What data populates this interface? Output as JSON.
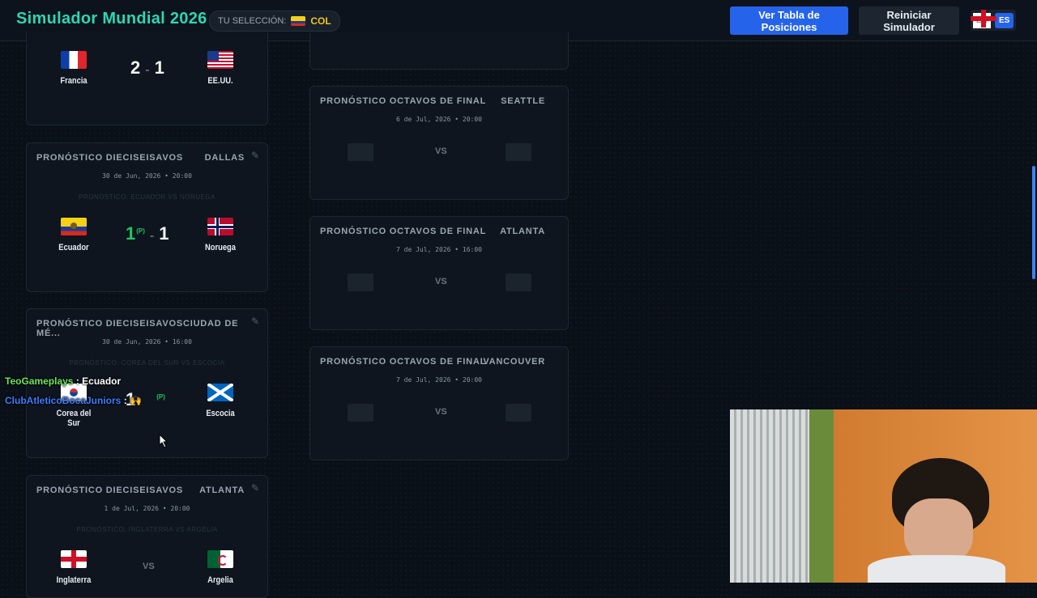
{
  "header": {
    "title": "Simulador Mundial 2026",
    "selection_label": "TU SELECCIÓN:",
    "selection_code": "COL",
    "btn_table": "Ver Tabla de Posiciones",
    "btn_reset": "Reiniciar Simulador",
    "lang_en": "EN",
    "lang_es": "ES"
  },
  "left": {
    "card0": {
      "home": "Francia",
      "away": "EE.UU.",
      "home_score": "2",
      "away_score": "1"
    },
    "card1": {
      "title": "PRONÓSTICO DIECISEISAVOS",
      "venue": "DALLAS",
      "date": "30 de Jun, 2026 • 20:00",
      "pred": "PRONÓSTICO: ECUADOR VS NORUEGA",
      "home": "Ecuador",
      "away": "Noruega",
      "home_score": "1",
      "pen": "(P)",
      "away_score": "1"
    },
    "card2": {
      "title": "PRONÓSTICO DIECISEISAVOSCIUDAD DE MÉ...",
      "date": "30 de Jun, 2026 • 16:00",
      "pred": "PRONÓSTICO: COREA DEL SUR VS ESCOCIA",
      "home": "Corea del Sur",
      "away": "Escocia",
      "home_score": "1",
      "pen": "(P)"
    },
    "card3": {
      "title": "PRONÓSTICO DIECISEISAVOS",
      "venue": "ATLANTA",
      "date": "1 de Jul, 2026 • 20:00",
      "pred": "PRONÓSTICO: INGLATERRA VS ARGELIA",
      "home": "Inglaterra",
      "away": "Argelia",
      "vs": "VS"
    }
  },
  "right": {
    "card1": {
      "title": "PRONÓSTICO OCTAVOS DE FINAL",
      "venue": "SEATTLE",
      "date": "6 de Jul, 2026 • 20:00",
      "vs": "VS"
    },
    "card2": {
      "title": "PRONÓSTICO OCTAVOS DE FINAL",
      "venue": "ATLANTA",
      "date": "7 de Jul, 2026 • 16:00",
      "vs": "VS"
    },
    "card3": {
      "title": "PRONÓSTICO OCTAVOS DE FINAL",
      "venue": "VANCOUVER",
      "date": "7 de Jul, 2026 • 20:00",
      "vs": "VS"
    }
  },
  "chat": [
    {
      "user": "TeoGameplays",
      "text": "Ecuador"
    },
    {
      "user": "ClubAtleticoBocaJuniors",
      "text": "🙌"
    }
  ],
  "icons": {
    "edit": "pencil-icon",
    "cursor": "mouse-cursor-icon"
  }
}
